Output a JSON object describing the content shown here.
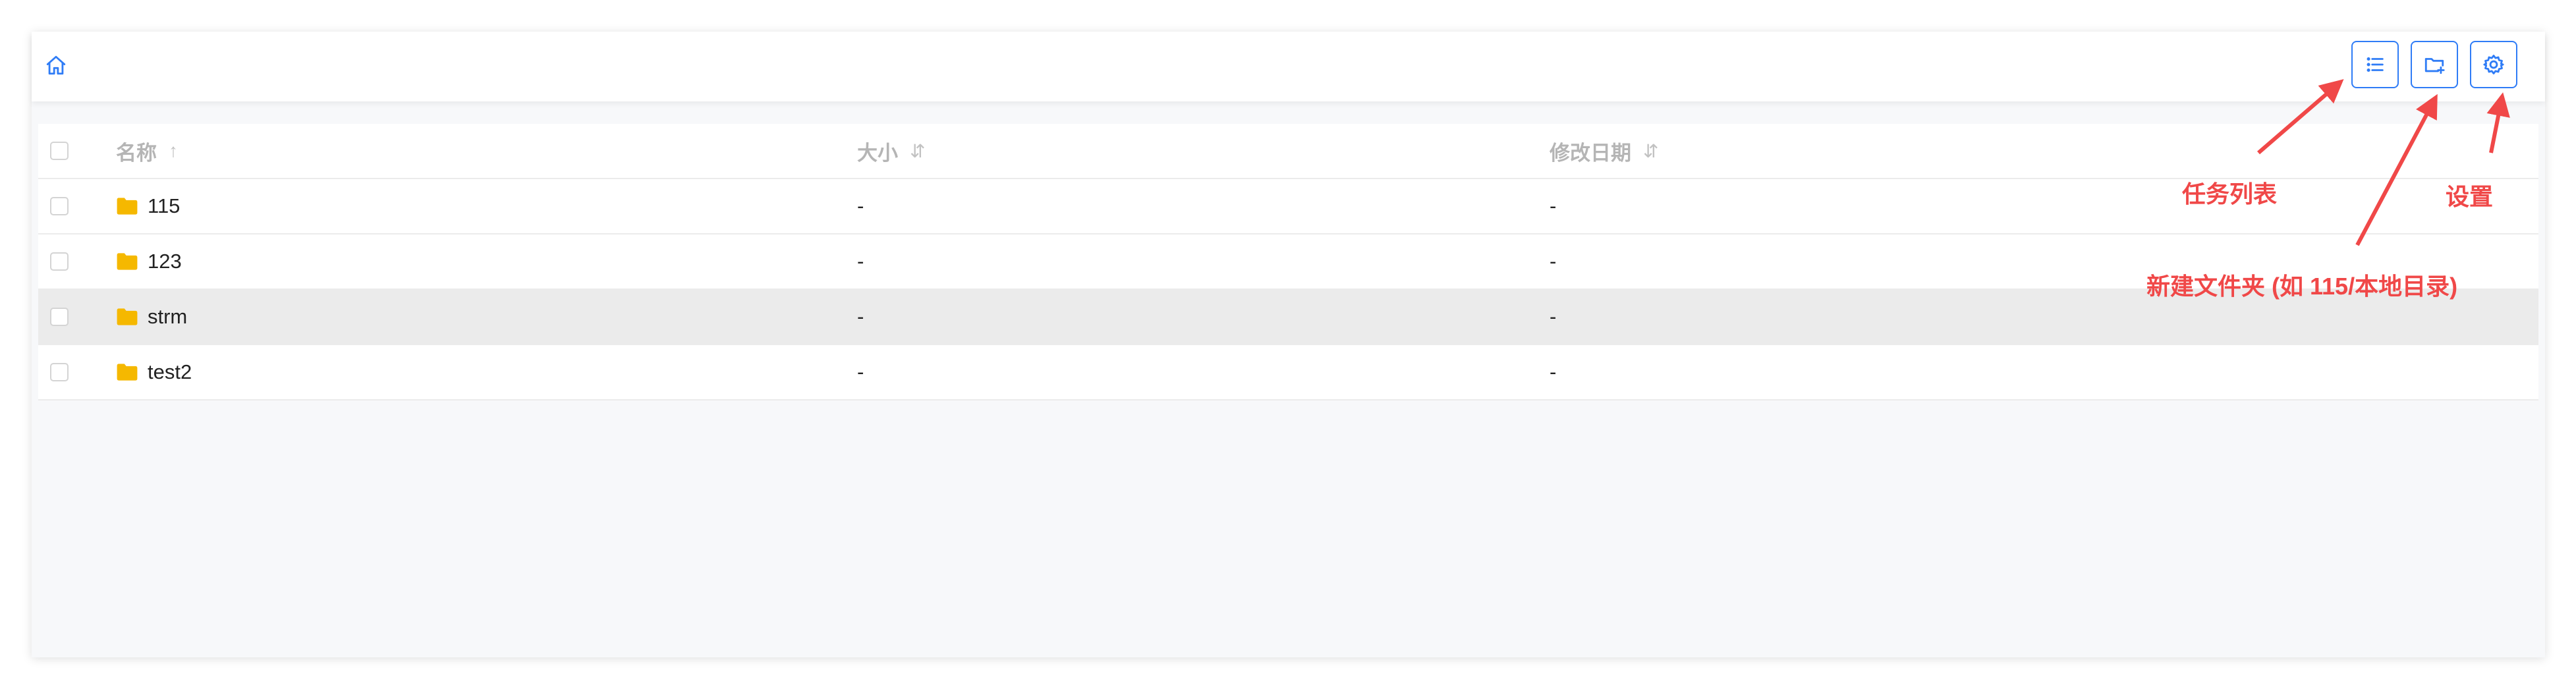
{
  "toolbar": {
    "home_icon": "home-icon",
    "buttons": [
      {
        "icon": "list-icon",
        "tooltip": "任务列表"
      },
      {
        "icon": "folder-plus-icon",
        "tooltip": "新建文件夹"
      },
      {
        "icon": "gear-icon",
        "tooltip": "设置"
      }
    ]
  },
  "table": {
    "columns": {
      "name": "名称",
      "name_sort": "↑",
      "size": "大小",
      "size_sort": "⇵",
      "date": "修改日期",
      "date_sort": "⇵"
    },
    "rows": [
      {
        "name": "115",
        "size": "-",
        "date": "-"
      },
      {
        "name": "123",
        "size": "-",
        "date": "-"
      },
      {
        "name": "strm",
        "size": "-",
        "date": "-"
      },
      {
        "name": "test2",
        "size": "-",
        "date": "-"
      }
    ]
  },
  "annotations": {
    "task_list": "任务列表",
    "settings": "设置",
    "new_folder": "新建文件夹 (如 115/本地目录)"
  },
  "colors": {
    "accent": "#2f7cf6",
    "annotation": "#f04848",
    "folder": "#f5b800",
    "selected_row": "#ebebeb"
  }
}
